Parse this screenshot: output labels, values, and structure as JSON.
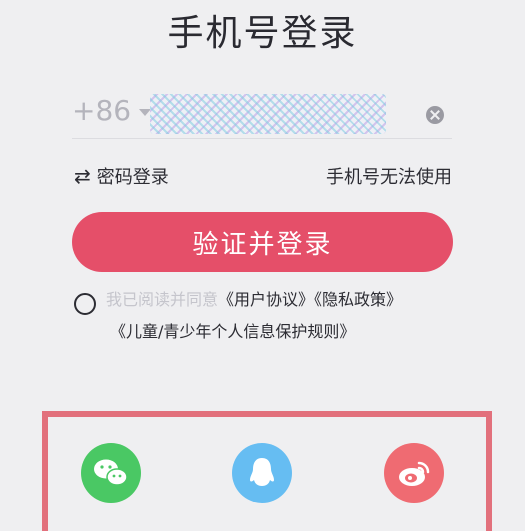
{
  "title": "手机号登录",
  "phone": {
    "country_code": "+86",
    "value": ""
  },
  "links": {
    "password_login": "密码登录",
    "phone_unusable": "手机号无法使用"
  },
  "submit_label": "验证并登录",
  "agreement": {
    "prefix": "我已阅读并同意",
    "user_agreement": "《用户协议》",
    "privacy_policy": "《隐私政策》",
    "children_rules": "《儿童/青少年个人信息保护规则》"
  },
  "social": [
    "wechat-icon",
    "qq-icon",
    "weibo-icon"
  ],
  "colors": {
    "accent": "#e54f69",
    "wechat": "#4ac864",
    "qq": "#66bdf2",
    "weibo": "#ef6b72",
    "highlight_frame": "#e2707c"
  }
}
